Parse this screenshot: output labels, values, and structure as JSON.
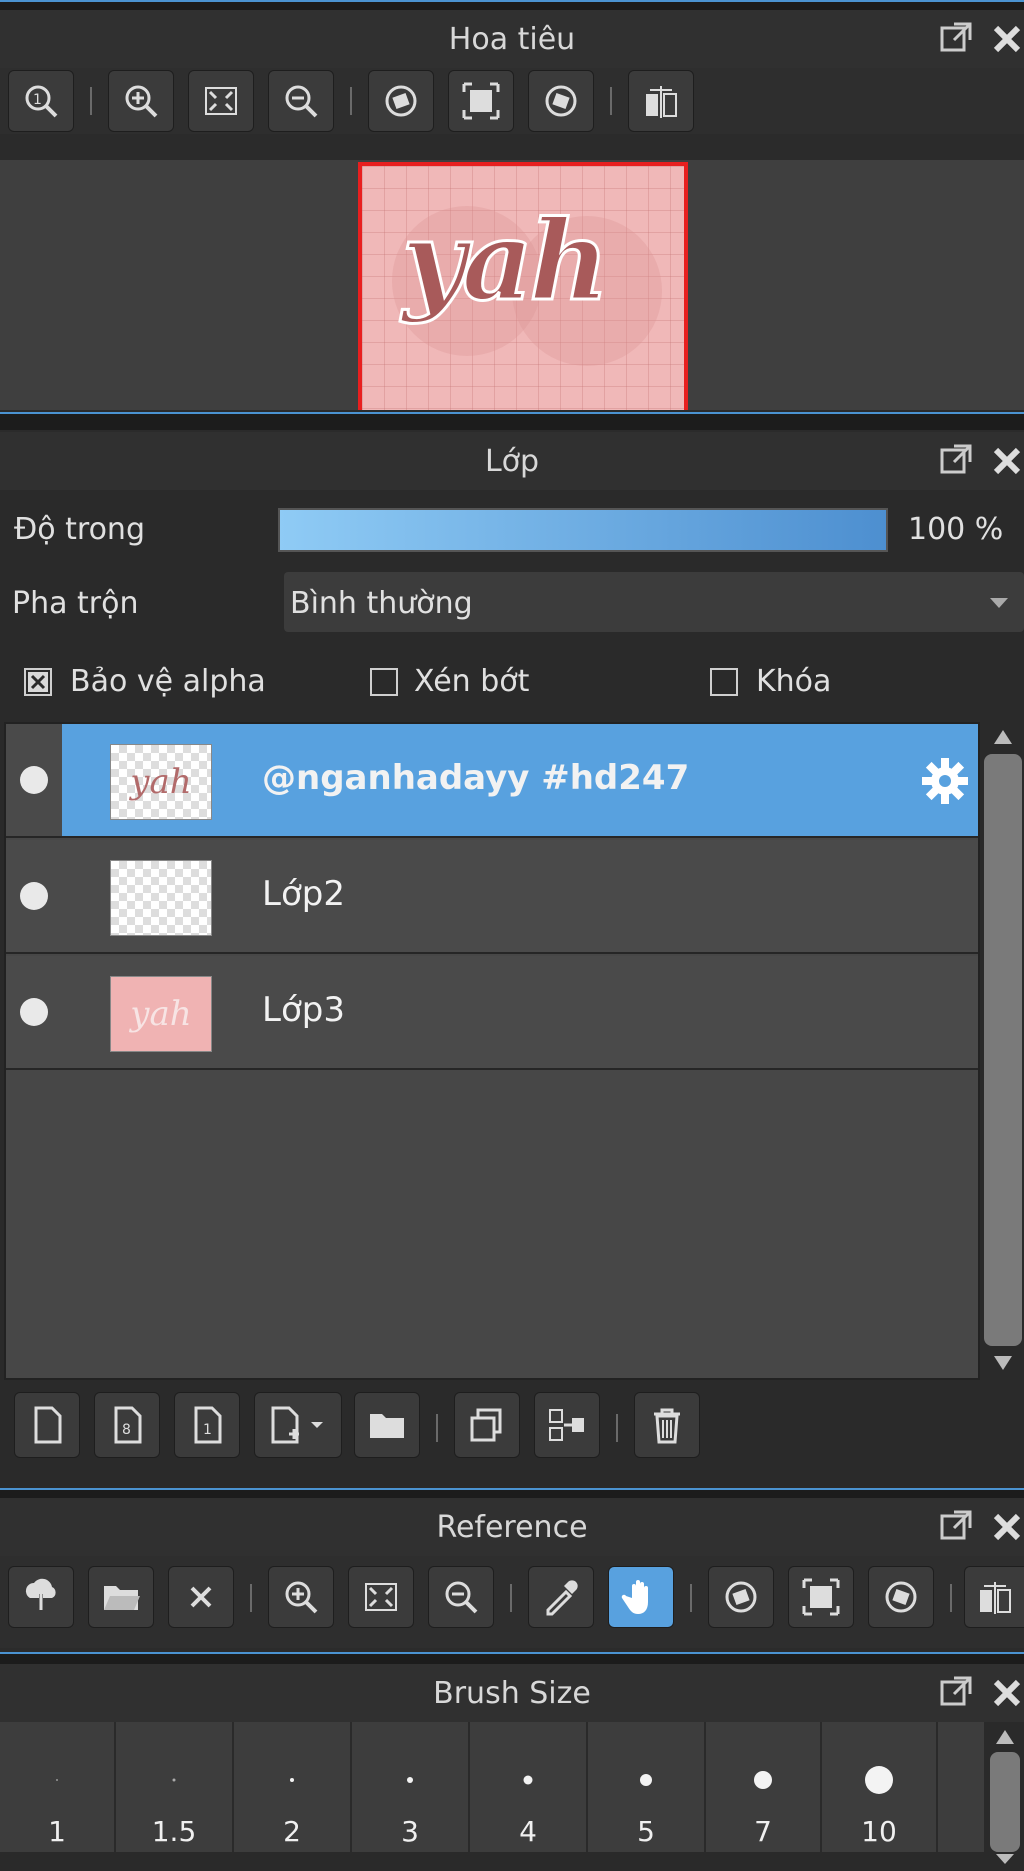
{
  "navigator": {
    "title": "Hoa tiêu",
    "tools": [
      "zoom-actual-icon",
      "zoom-in-icon",
      "fit-screen-icon",
      "zoom-out-icon",
      "rotate-left-icon",
      "fit-canvas-icon",
      "rotate-right-icon",
      "flip-horizontal-icon"
    ],
    "preview_text": "yah"
  },
  "layers": {
    "title": "Lớp",
    "opacity_label": "Độ trong",
    "opacity_value": "100 %",
    "opacity": 1.0,
    "blend_label": "Pha trộn",
    "blend_value": "Bình thường",
    "protect_alpha_label": "Bảo vệ alpha",
    "protect_alpha_checked": true,
    "clip_label": "Xén bớt",
    "clip_checked": false,
    "lock_label": "Khóa",
    "lock_checked": false,
    "items": [
      {
        "name": "@nganhadayy #hd247",
        "selected": true,
        "thumb": "yah"
      },
      {
        "name": "Lớp2",
        "selected": false,
        "thumb": ""
      },
      {
        "name": "Lớp3",
        "selected": false,
        "thumb": "yah"
      }
    ],
    "bottom_tools": [
      "new-layer-icon",
      "new-8bit-layer-icon",
      "new-1bit-layer-icon",
      "add-layer-menu-icon",
      "new-folder-icon",
      "duplicate-layer-icon",
      "merge-down-icon",
      "delete-layer-icon"
    ]
  },
  "reference": {
    "title": "Reference",
    "tools": [
      "import-icon",
      "open-folder-icon",
      "close-icon",
      "zoom-in-icon",
      "fit-screen-icon",
      "zoom-out-icon",
      "eyedropper-icon",
      "hand-icon",
      "rotate-left-icon",
      "fit-canvas-icon",
      "rotate-right-icon",
      "flip-horizontal-icon"
    ]
  },
  "brush_size": {
    "title": "Brush Size",
    "sizes": [
      "1",
      "1.5",
      "2",
      "3",
      "4",
      "5",
      "7",
      "10"
    ]
  },
  "colors": {
    "accent": "#58a1df",
    "panel": "#2b2b2b",
    "selection": "#58a1df"
  }
}
